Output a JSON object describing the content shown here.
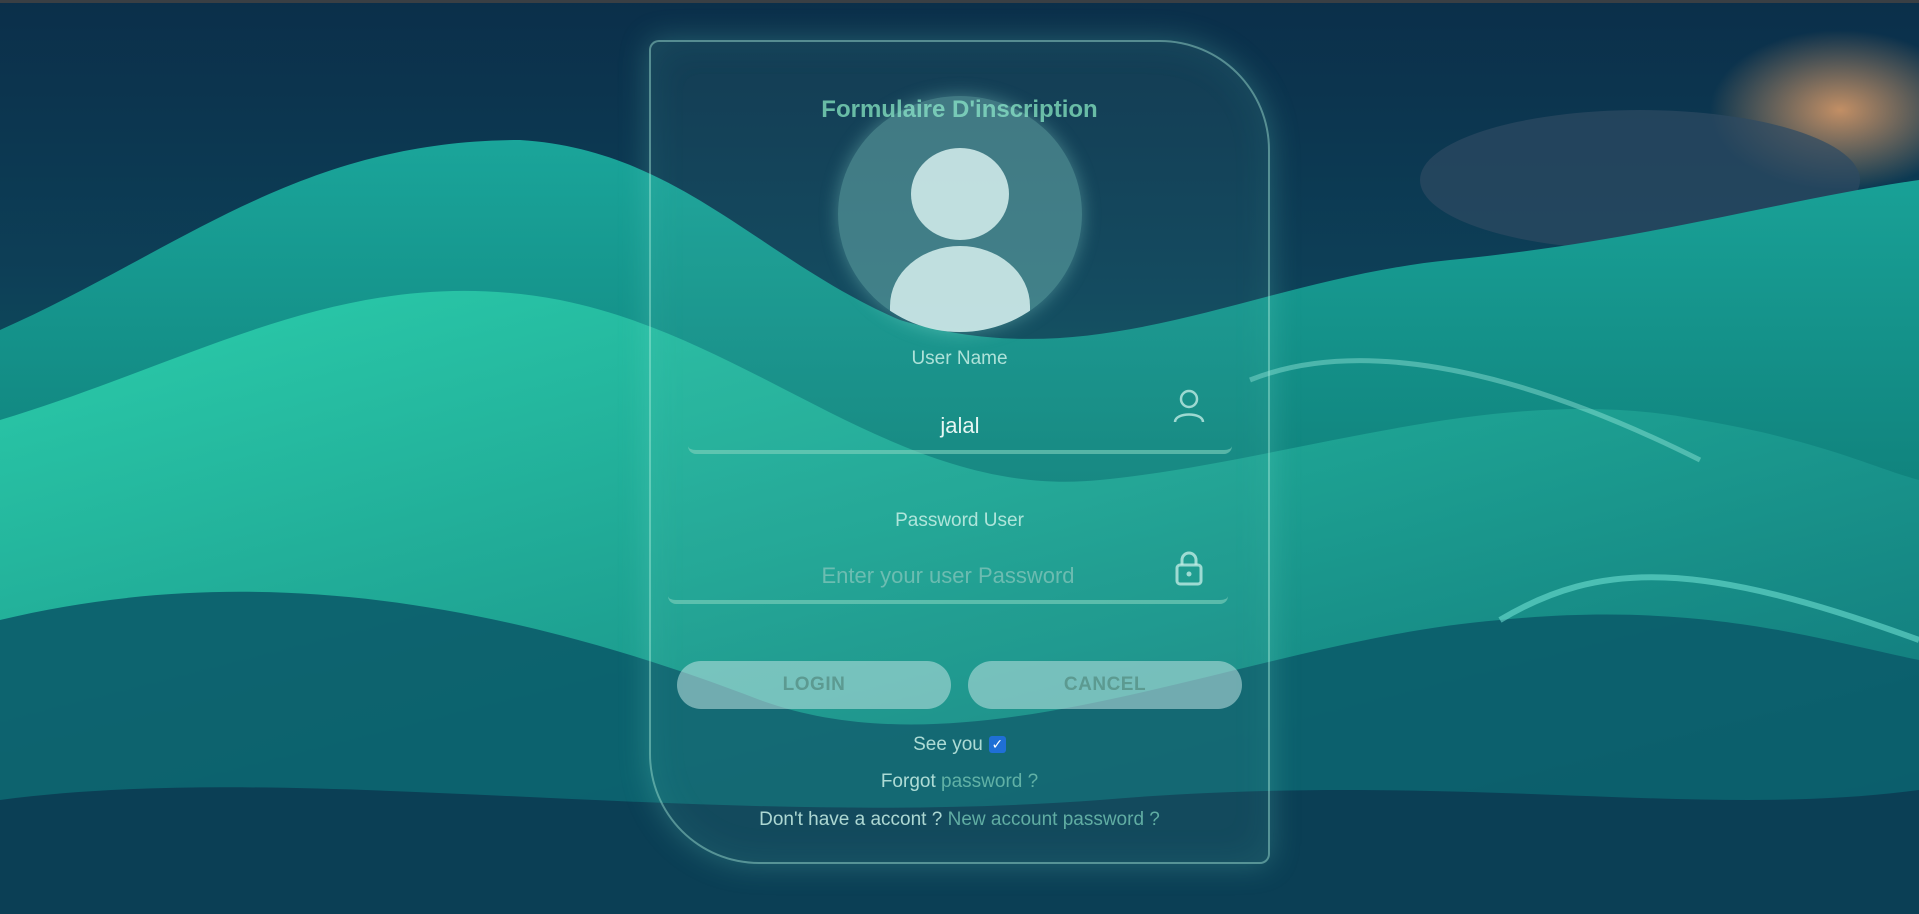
{
  "form": {
    "title": "Formulaire D'inscription",
    "username_label": "User Name",
    "username_value": "jalal",
    "password_label": "Password User",
    "password_placeholder": "Enter your user Password",
    "login_label": "LOGIN",
    "cancel_label": "CANCEL",
    "remember_label": "See you",
    "remember_checked": true,
    "forgot_prefix": "Forgot",
    "forgot_link": "password ?",
    "signup_prefix": "Don't have a accont ?",
    "signup_link": "New account password ?"
  },
  "icons": {
    "avatar": "user-avatar-icon",
    "username": "user-outline-icon",
    "password": "lock-icon"
  },
  "colors": {
    "accent": "#78d2b4",
    "checkbox": "#1f6fd6"
  }
}
